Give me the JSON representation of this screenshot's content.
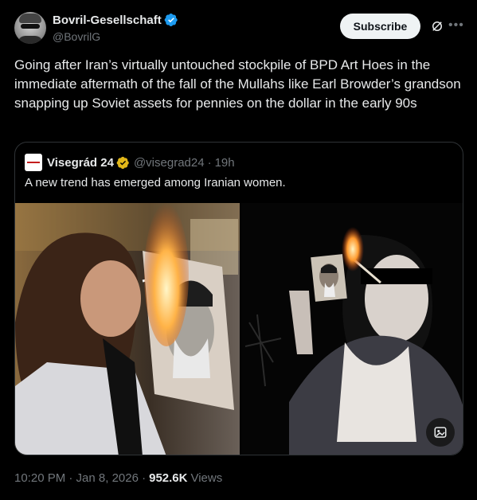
{
  "author": {
    "display_name": "Bovril-Gesellschaft",
    "handle": "@BovrilG"
  },
  "actions": {
    "subscribe_label": "Subscribe"
  },
  "tweet": {
    "text": "Going after Iran’s virtually untouched stockpile of BPD Art Hoes in the immediate aftermath of the fall of the Mullahs like Earl Browder’s grandson snapping up Soviet assets for pennies on the dollar in the early 90s"
  },
  "quoted": {
    "display_name": "Visegrád 24",
    "handle": "@visegrad24",
    "separator": "·",
    "time": "19h",
    "text": "A new trend has emerged among Iranian women."
  },
  "meta": {
    "time": "10:20 PM · Jan 8, 2026 ·",
    "views_count": "952.6K",
    "views_label": "Views"
  },
  "colors": {
    "background": "#000000",
    "text": "#e7e9ea",
    "muted": "#71767b",
    "verified_blue": "#1d9bf0",
    "gold_badge": "#e2b719",
    "border": "#2f3336"
  },
  "icons": [
    "verified-badge-icon",
    "grok-icon",
    "more-icon",
    "gold-verified-icon",
    "alt-text-icon"
  ]
}
